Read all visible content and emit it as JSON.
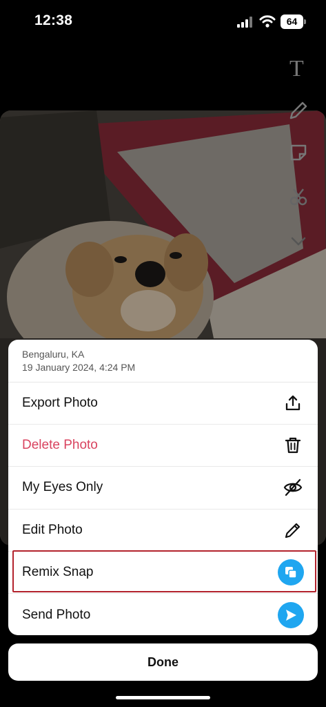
{
  "status_bar": {
    "time": "12:38",
    "battery": "64"
  },
  "toolbar": {
    "text_tool_icon": "text-tool-icon",
    "pencil_icon": "pencil-icon",
    "sticker_icon": "sticker-icon",
    "scissors_icon": "scissors-icon",
    "more_icon": "chevron-down-icon"
  },
  "sheet": {
    "location": "Bengaluru, KA",
    "date": "19 January 2024, 4:24 PM",
    "items": [
      {
        "label": "Export Photo",
        "icon": "export-icon"
      },
      {
        "label": "Delete Photo",
        "icon": "trash-icon",
        "color": "#d9435f"
      },
      {
        "label": "My Eyes Only",
        "icon": "eye-off-icon"
      },
      {
        "label": "Edit Photo",
        "icon": "pencil-icon"
      },
      {
        "label": "Remix Snap",
        "icon": "remix-icon",
        "icon_bg": "#1fa6f0"
      },
      {
        "label": "Send Photo",
        "icon": "send-icon",
        "icon_bg": "#1fa6f0"
      }
    ]
  },
  "done_label": "Done",
  "colors": {
    "highlight": "#b3222c",
    "accent": "#1fa6f0",
    "danger": "#d9435f"
  }
}
